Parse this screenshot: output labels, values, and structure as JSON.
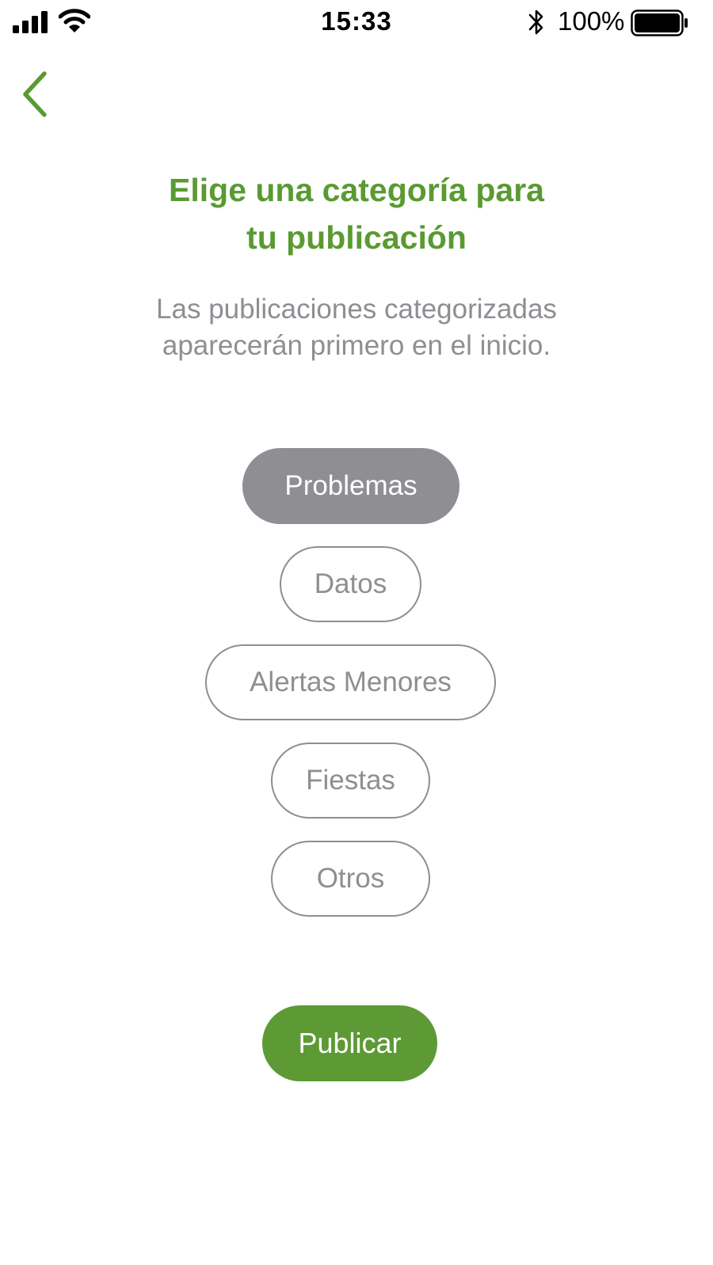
{
  "status_bar": {
    "time": "15:33",
    "battery_percent": "100%",
    "battery_level": 1.0,
    "icons": [
      "signal-icon",
      "wifi-icon",
      "bluetooth-icon",
      "battery-icon"
    ]
  },
  "nav": {
    "back_icon": "chevron-left-icon"
  },
  "header": {
    "title_line1": "Elige una categoría para",
    "title_line2": "tu publicación",
    "subtitle_line1": "Las publicaciones categorizadas",
    "subtitle_line2": "aparecerán primero en el inicio."
  },
  "categories": [
    {
      "label": "Problemas",
      "selected": true
    },
    {
      "label": "Datos",
      "selected": false
    },
    {
      "label": "Alertas Menores",
      "selected": false
    },
    {
      "label": "Fiestas",
      "selected": false
    },
    {
      "label": "Otros",
      "selected": false
    }
  ],
  "actions": {
    "publish_label": "Publicar"
  },
  "colors": {
    "accent": "#5a9a32",
    "publish_bg": "#5d9a35",
    "muted": "#8e8e93",
    "background": "#ffffff"
  }
}
